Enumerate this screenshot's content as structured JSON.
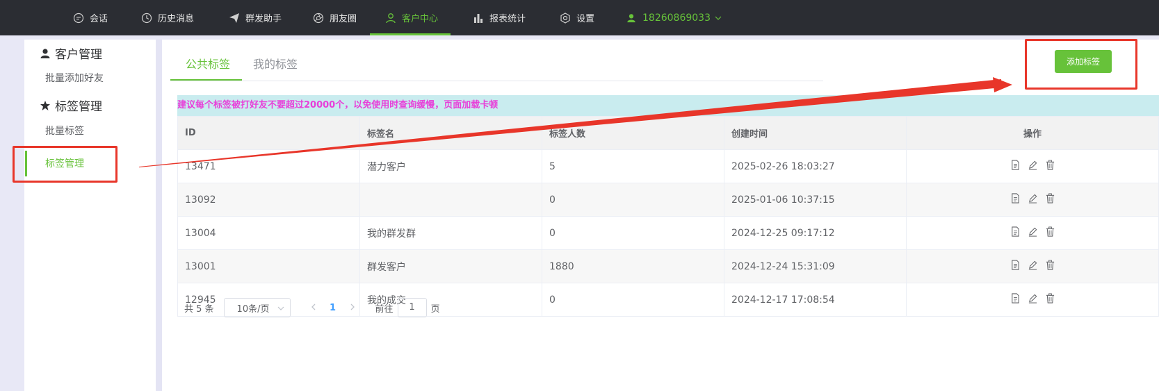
{
  "topnav": {
    "items": [
      {
        "label": "会话",
        "icon": "chat-icon"
      },
      {
        "label": "历史消息",
        "icon": "clock-icon"
      },
      {
        "label": "群发助手",
        "icon": "send-icon"
      },
      {
        "label": "朋友圈",
        "icon": "aperture-icon"
      },
      {
        "label": "客户中心",
        "icon": "user-icon",
        "active": true
      },
      {
        "label": "报表统计",
        "icon": "bar-chart-icon"
      },
      {
        "label": "设置",
        "icon": "gear-icon"
      }
    ],
    "user": {
      "phone": "18260869033",
      "icon": "user-icon"
    },
    "accent": "#67c23a"
  },
  "sidebar": {
    "groups": [
      {
        "title": "客户管理",
        "icon": "person-icon",
        "items": [
          {
            "label": "批量添加好友"
          }
        ]
      },
      {
        "title": "标签管理",
        "icon": "star-icon",
        "items": [
          {
            "label": "批量标签"
          },
          {
            "label": "标签管理",
            "active": true
          }
        ]
      }
    ]
  },
  "tabs": [
    {
      "label": "公共标签",
      "active": true
    },
    {
      "label": "我的标签"
    }
  ],
  "add_button_label": "添加标签",
  "notice": "建议每个标签被打好友不要超过20000个，以免使用时查询缓慢，页面加载卡顿",
  "table": {
    "columns": [
      "ID",
      "标签名",
      "标签人数",
      "创建时间",
      "操作"
    ],
    "rows": [
      {
        "id": "13471",
        "name": "潜力客户",
        "count": "5",
        "created": "2025-02-26 18:03:27"
      },
      {
        "id": "13092",
        "name": "",
        "count": "0",
        "created": "2025-01-06 10:37:15"
      },
      {
        "id": "13004",
        "name": "我的群发群",
        "count": "0",
        "created": "2024-12-25 09:17:12"
      },
      {
        "id": "13001",
        "name": "群发客户",
        "count": "1880",
        "created": "2024-12-24 15:31:09"
      },
      {
        "id": "12945",
        "name": "我的成交",
        "count": "0",
        "created": "2024-12-17 17:08:54"
      }
    ],
    "row_actions": [
      "document-icon",
      "edit-icon",
      "trash-icon"
    ]
  },
  "pagination": {
    "total": "共 5 条",
    "page_size": "10条/页",
    "current_page": "1",
    "goto_prefix": "前往",
    "goto_value": "1",
    "goto_suffix": "页"
  },
  "annotation_color": "#e8362a"
}
